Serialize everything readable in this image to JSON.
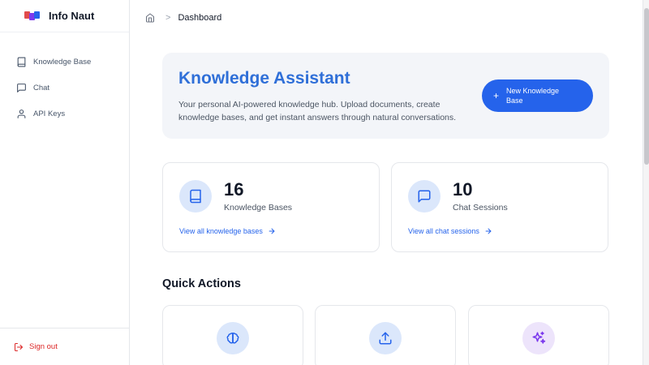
{
  "app": {
    "name": "Info Naut"
  },
  "sidebar": {
    "items": [
      {
        "label": "Knowledge Base",
        "icon": "book-icon"
      },
      {
        "label": "Chat",
        "icon": "message-icon"
      },
      {
        "label": "API Keys",
        "icon": "user-icon"
      }
    ],
    "signout_label": "Sign out"
  },
  "breadcrumb": {
    "separator": ">",
    "current": "Dashboard"
  },
  "hero": {
    "title": "Knowledge Assistant",
    "description": "Your personal AI-powered knowledge hub. Upload documents, create knowledge bases, and get instant answers through natural conversations.",
    "button_label": "New Knowledge Base",
    "button_icon": "+"
  },
  "stats": [
    {
      "value": "16",
      "label": "Knowledge Bases",
      "link": "View all knowledge bases",
      "icon": "book-icon"
    },
    {
      "value": "10",
      "label": "Chat Sessions",
      "link": "View all chat sessions",
      "icon": "message-icon"
    }
  ],
  "quick_actions": {
    "title": "Quick Actions",
    "cards": [
      {
        "icon": "brain-icon"
      },
      {
        "icon": "upload-icon"
      },
      {
        "icon": "sparkles-icon"
      }
    ]
  },
  "colors": {
    "accent": "#2563eb",
    "title_blue": "#2f6fd8",
    "danger": "#dc2626",
    "icon_bg_blue": "#dbe7fb",
    "icon_bg_purple": "#ede4fb"
  }
}
